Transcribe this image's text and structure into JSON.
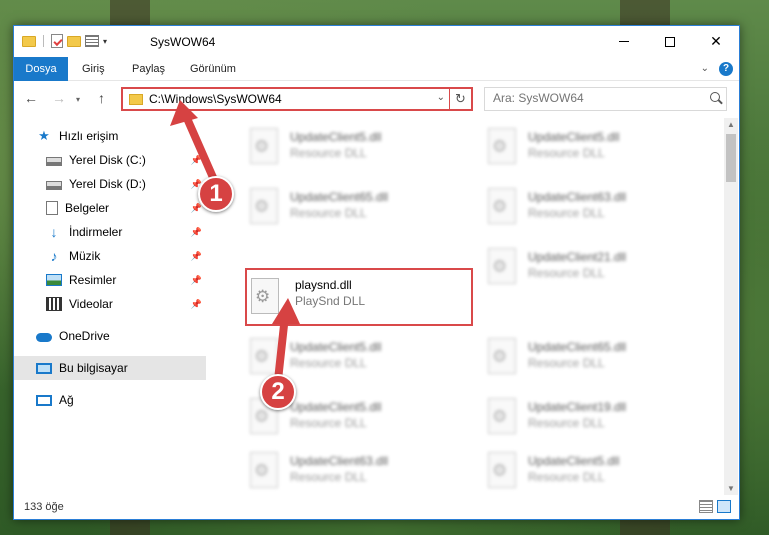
{
  "window": {
    "title": "SysWOW64",
    "minimize": "—",
    "maximize": "☐",
    "close": "✕"
  },
  "ribbon": {
    "tabs": [
      "Dosya",
      "Giriş",
      "Paylaş",
      "Görünüm"
    ],
    "help": "?"
  },
  "address": {
    "path": "C:\\Windows\\SysWOW64"
  },
  "search": {
    "placeholder": "Ara: SysWOW64"
  },
  "sidebar": {
    "items": [
      {
        "label": "Hızlı erişim"
      },
      {
        "label": "Yerel Disk (C:)"
      },
      {
        "label": "Yerel Disk (D:)"
      },
      {
        "label": "Belgeler"
      },
      {
        "label": "İndirmeler"
      },
      {
        "label": "Müzik"
      },
      {
        "label": "Resimler"
      },
      {
        "label": "Videolar"
      },
      {
        "label": "OneDrive"
      },
      {
        "label": "Bu bilgisayar"
      },
      {
        "label": "Ağ"
      }
    ]
  },
  "files": [
    {
      "name": "UpdateClient5.dll",
      "type": "Resource DLL"
    },
    {
      "name": "UpdateClient5.dll",
      "type": "Resource DLL"
    },
    {
      "name": "UpdateClient65.dll",
      "type": "Resource DLL"
    },
    {
      "name": "UpdateClient63.dll",
      "type": "Resource DLL"
    },
    {
      "name": "playsnd.dll",
      "type": "PlaySnd DLL"
    },
    {
      "name": "UpdateClient21.dll",
      "type": "Resource DLL"
    },
    {
      "name": "UpdateClient5.dll",
      "type": "Resource DLL"
    },
    {
      "name": "UpdateClient65.dll",
      "type": "Resource DLL"
    },
    {
      "name": "UpdateClient5.dll",
      "type": "Resource DLL"
    },
    {
      "name": "UpdateClient19.dll",
      "type": "Resource DLL"
    },
    {
      "name": "UpdateClient63.dll",
      "type": "Resource DLL"
    },
    {
      "name": "UpdateClient5.dll",
      "type": "Resource DLL"
    }
  ],
  "status": {
    "item_count": "133 öğe"
  },
  "annotations": {
    "step1": "1",
    "step2": "2"
  },
  "colors": {
    "accent": "#1979ca",
    "highlight_red": "#d9494a"
  }
}
